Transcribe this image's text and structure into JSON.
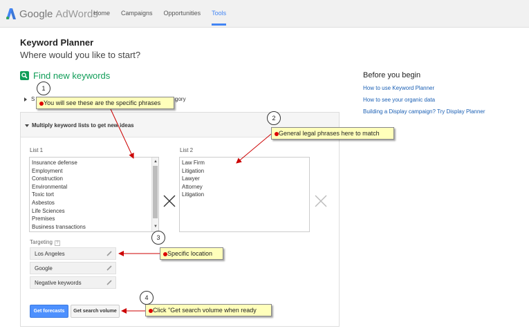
{
  "header": {
    "brand_google": "Google",
    "brand_product": "AdWords",
    "nav": [
      {
        "label": "Home"
      },
      {
        "label": "Campaigns"
      },
      {
        "label": "Opportunities"
      },
      {
        "label": "Tools",
        "active": true
      }
    ]
  },
  "page": {
    "title": "Keyword Planner",
    "subtitle": "Where would you like to start?"
  },
  "find": {
    "label": "Find new keywords",
    "row_prefix": "S",
    "row_suffix": "gory"
  },
  "before": {
    "heading": "Before you begin",
    "links": [
      "How to use Keyword Planner",
      "How to see your organic data",
      "Building a Display campaign? Try Display Planner"
    ]
  },
  "panel": {
    "title": "Multiply keyword lists to get new ideas",
    "list1_label": "List 1",
    "list1": [
      "Insurance defense",
      "Employment",
      "Construction",
      "Environmental",
      "Toxic tort",
      "Asbestos",
      "Life Sciences",
      "Premises",
      "Business transactions"
    ],
    "list2_label": "List 2",
    "list2": [
      "Law Firm",
      "Litigation",
      "Lawyer",
      "Attorney",
      "Litigation"
    ],
    "targeting_label": "Targeting",
    "help_glyph": "?",
    "targeting": [
      "Los Angeles",
      "Google",
      "Negative keywords"
    ],
    "btn_forecasts": "Get forecasts",
    "btn_volume": "Get search volume"
  },
  "annotations": [
    {
      "num": "1",
      "text": "You will see these are the specific phrases"
    },
    {
      "num": "2",
      "text": "General legal phrases here to match"
    },
    {
      "num": "3",
      "text": "Specific location"
    },
    {
      "num": "4",
      "text": "Click \"Get search volume when ready"
    }
  ],
  "colors": {
    "accent_blue": "#4285f4",
    "find_green": "#109d58",
    "callout_bg": "#ffffbb",
    "arrow_red": "#cc0000"
  }
}
